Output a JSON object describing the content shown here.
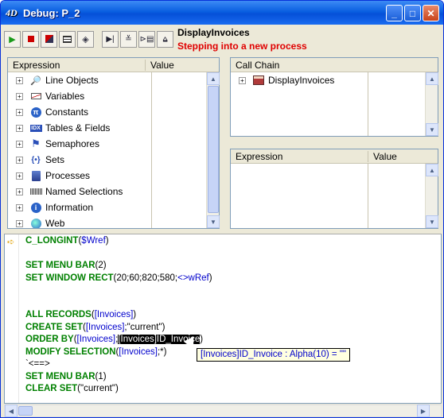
{
  "window": {
    "title": "Debug: P_2",
    "minimize": "_",
    "maximize": "□",
    "close": "✕"
  },
  "toolbar": {
    "buttons": [
      {
        "name": "run-button",
        "icon": "play-icon"
      },
      {
        "name": "abort-button",
        "icon": "stop-icon"
      },
      {
        "name": "abort-and-edit-button",
        "icon": "abort-edit-icon"
      },
      {
        "name": "edit-button",
        "icon": "edit-icon"
      },
      {
        "name": "trace-button",
        "icon": "trace-icon"
      },
      {
        "name": "step-over-button",
        "icon": "step-over-icon"
      },
      {
        "name": "step-into-button",
        "icon": "step-into-icon"
      },
      {
        "name": "step-into-process-button",
        "icon": "step-process-icon"
      },
      {
        "name": "step-out-button",
        "icon": "step-out-icon"
      }
    ],
    "routine": "DisplayInvoices",
    "status": "Stepping into a new process",
    "status_color": "#e00000"
  },
  "watch_pane": {
    "col_expression": "Expression",
    "col_value": "Value",
    "items": [
      {
        "label": "Line Objects",
        "icon": "magnifier-icon"
      },
      {
        "label": "Variables",
        "icon": "variable-icon"
      },
      {
        "label": "Constants",
        "icon": "pi-icon"
      },
      {
        "label": "Tables & Fields",
        "icon": "table-icon"
      },
      {
        "label": "Semaphores",
        "icon": "semaphore-icon"
      },
      {
        "label": "Sets",
        "icon": "set-icon"
      },
      {
        "label": "Processes",
        "icon": "process-icon"
      },
      {
        "label": "Named Selections",
        "icon": "selection-icon"
      },
      {
        "label": "Information",
        "icon": "info-icon"
      },
      {
        "label": "Web",
        "icon": "web-icon"
      }
    ]
  },
  "call_chain": {
    "header": "Call Chain",
    "items": [
      {
        "label": "DisplayInvoices",
        "icon": "method-icon"
      }
    ]
  },
  "custom_watch": {
    "col_expression": "Expression",
    "col_value": "Value"
  },
  "code": {
    "lines": [
      [
        {
          "t": "kw",
          "v": "C_LONGINT"
        },
        {
          "t": "tx",
          "v": "("
        },
        {
          "t": "ar",
          "v": "$Wref"
        },
        {
          "t": "tx",
          "v": ")"
        }
      ],
      [],
      [
        {
          "t": "kw",
          "v": "SET MENU BAR"
        },
        {
          "t": "tx",
          "v": "(2)"
        }
      ],
      [
        {
          "t": "kw",
          "v": "SET WINDOW RECT"
        },
        {
          "t": "tx",
          "v": "(20;60;820;580;"
        },
        {
          "t": "ar",
          "v": "<>wRef"
        },
        {
          "t": "tx",
          "v": ")"
        }
      ],
      [],
      [],
      [
        {
          "t": "kw",
          "v": "ALL RECORDS"
        },
        {
          "t": "tx",
          "v": "("
        },
        {
          "t": "ar",
          "v": "[Invoices]"
        },
        {
          "t": "tx",
          "v": ")"
        }
      ],
      [
        {
          "t": "kw",
          "v": "CREATE SET"
        },
        {
          "t": "tx",
          "v": "("
        },
        {
          "t": "ar",
          "v": "[Invoices]"
        },
        {
          "t": "tx",
          "v": ";\"current\")"
        }
      ],
      [
        {
          "t": "kw",
          "v": "ORDER BY"
        },
        {
          "t": "tx",
          "v": "("
        },
        {
          "t": "ar",
          "v": "[Invoices]"
        },
        {
          "t": "tx",
          "v": ";"
        },
        {
          "t": "sel",
          "v": "[Invoices]ID_Invoice"
        },
        {
          "t": "tx",
          "v": ")"
        }
      ],
      [
        {
          "t": "kw",
          "v": "MODIFY SELECTION"
        },
        {
          "t": "tx",
          "v": "("
        },
        {
          "t": "ar",
          "v": "[Invoices]"
        },
        {
          "t": "tx",
          "v": ";*)"
        }
      ],
      [
        {
          "t": "tx",
          "v": "`<==>"
        }
      ],
      [
        {
          "t": "kw",
          "v": "SET MENU BAR"
        },
        {
          "t": "tx",
          "v": "(1)"
        }
      ],
      [
        {
          "t": "kw",
          "v": "CLEAR SET"
        },
        {
          "t": "tx",
          "v": "(\"current\")"
        }
      ]
    ],
    "tooltip": "[Invoices]ID_Invoice : Alpha(10) = \"\""
  }
}
